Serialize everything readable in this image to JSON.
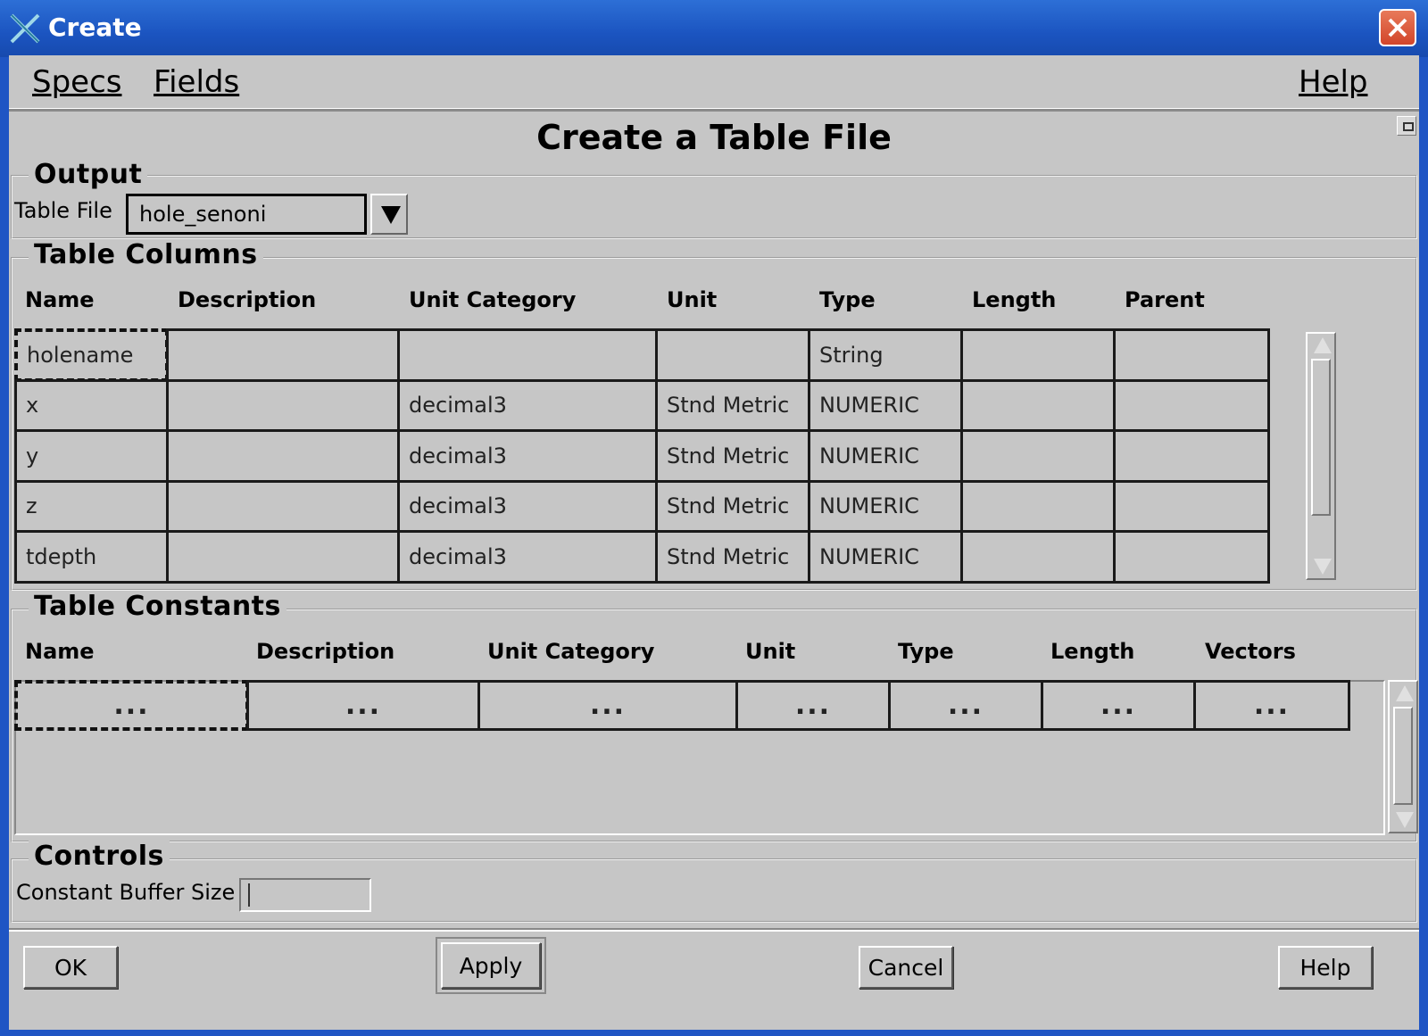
{
  "window": {
    "title": "Create"
  },
  "menu": {
    "specs": "Specs",
    "fields": "Fields",
    "help": "Help"
  },
  "heading": "Create a Table File",
  "output": {
    "group_label": "Output",
    "table_file_label": "Table File",
    "table_file_value": "hole_senoni"
  },
  "table_columns": {
    "group_label": "Table Columns",
    "headers": [
      "Name",
      "Description",
      "Unit Category",
      "Unit",
      "Type",
      "Length",
      "Parent"
    ],
    "rows": [
      [
        "holename",
        "",
        "",
        "",
        "String",
        "",
        ""
      ],
      [
        "x",
        "",
        "decimal3",
        "Stnd Metric",
        "NUMERIC",
        "",
        ""
      ],
      [
        "y",
        "",
        "decimal3",
        "Stnd Metric",
        "NUMERIC",
        "",
        ""
      ],
      [
        "z",
        "",
        "decimal3",
        "Stnd Metric",
        "NUMERIC",
        "",
        ""
      ],
      [
        "tdepth",
        "",
        "decimal3",
        "Stnd Metric",
        "NUMERIC",
        "",
        ""
      ]
    ]
  },
  "table_constants": {
    "group_label": "Table Constants",
    "headers": [
      "Name",
      "Description",
      "Unit Category",
      "Unit",
      "Type",
      "Length",
      "Vectors"
    ],
    "rows": [
      [
        "...",
        "...",
        "...",
        "...",
        "...",
        "...",
        "..."
      ]
    ]
  },
  "controls": {
    "group_label": "Controls",
    "buffer_label": "Constant Buffer Size",
    "buffer_value": ""
  },
  "buttons": {
    "ok": "OK",
    "apply": "Apply",
    "cancel": "Cancel",
    "help": "Help"
  },
  "colors": {
    "title_bar": "#1b54c0",
    "dialog_bg": "#c6c6c6",
    "close_button": "#d2452a"
  },
  "icons": {
    "app": "x-logo-icon",
    "close": "close-icon",
    "dropdown": "dropdown-arrow-icon"
  }
}
